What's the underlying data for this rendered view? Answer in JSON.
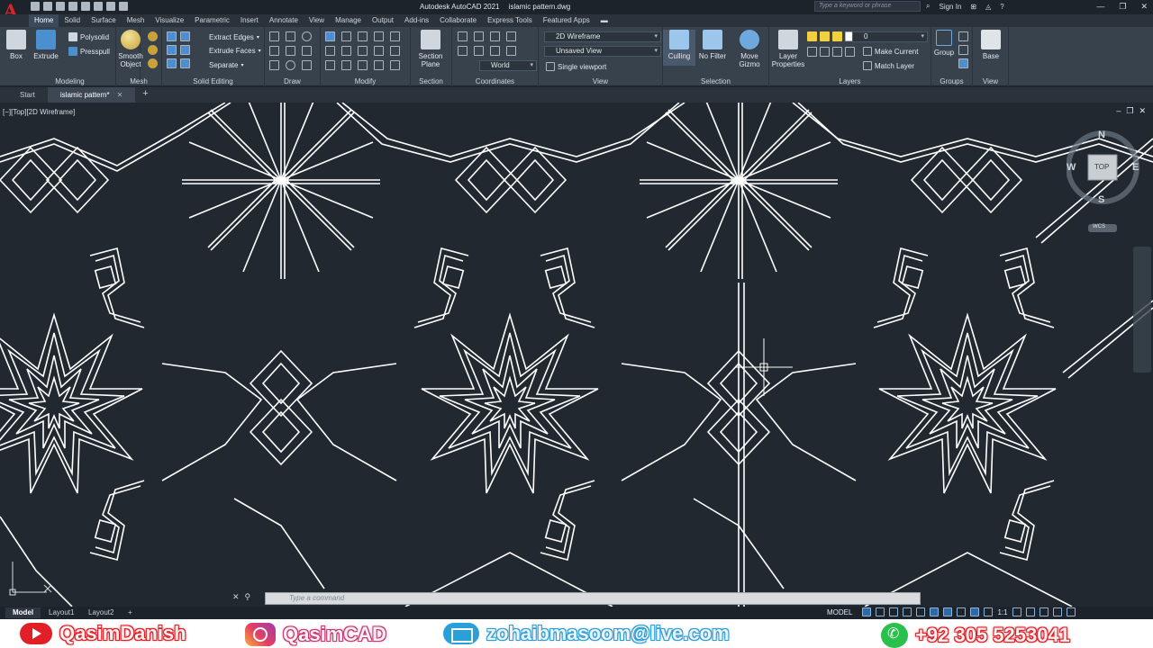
{
  "app": {
    "title": "Autodesk AutoCAD 2021",
    "filename": "islamic pattern.dwg",
    "search_placeholder": "Type a keyword or phrase",
    "sign_in": "Sign In"
  },
  "ribbon_tabs": [
    "Home",
    "Solid",
    "Surface",
    "Mesh",
    "Visualize",
    "Parametric",
    "Insert",
    "Annotate",
    "View",
    "Manage",
    "Output",
    "Add-ins",
    "Collaborate",
    "Express Tools",
    "Featured Apps"
  ],
  "ribbon": {
    "modeling": {
      "label": "Modeling",
      "box": "Box",
      "extrude": "Extrude",
      "polysolid": "Polysolid",
      "presspull": "Presspull"
    },
    "mesh": {
      "label": "Mesh",
      "smooth_object": "Smooth\nObject"
    },
    "solid_editing": {
      "label": "Solid Editing",
      "extract_edges": "Extract Edges",
      "extrude_faces": "Extrude Faces",
      "separate": "Separate"
    },
    "draw": {
      "label": "Draw"
    },
    "modify": {
      "label": "Modify"
    },
    "section": {
      "label": "Section",
      "section_plane": "Section\nPlane"
    },
    "coordinates": {
      "label": "Coordinates",
      "world": "World"
    },
    "view": {
      "label": "View",
      "visual_style": "2D Wireframe",
      "named_view": "Unsaved View",
      "viewport": "Single viewport"
    },
    "selection": {
      "label": "Selection",
      "culling": "Culling",
      "no_filter": "No Filter",
      "move_gizmo": "Move\nGizmo"
    },
    "layers": {
      "label": "Layers",
      "layer_properties": "Layer\nProperties",
      "current_layer": "0",
      "make_current": "Make Current",
      "match_layer": "Match Layer"
    },
    "groups": {
      "label": "Groups",
      "group": "Group"
    },
    "view2": {
      "label": "View",
      "base": "Base"
    }
  },
  "doc_tabs": [
    {
      "label": "Start"
    },
    {
      "label": "islamic pattern*"
    }
  ],
  "viewport": {
    "label": "[−][Top][2D Wireframe]",
    "viewcube_face": "TOP",
    "compass_n": "N",
    "compass_s": "S",
    "compass_e": "E",
    "compass_w": "W",
    "wcs": "WCS"
  },
  "command_line": {
    "placeholder": "Type a command"
  },
  "layout_tabs": [
    "Model",
    "Layout1",
    "Layout2"
  ],
  "status": {
    "space": "MODEL",
    "scale": "1:1"
  },
  "banner": {
    "youtube": "QasimDanish",
    "instagram": "QasimCAD",
    "email": "zohaibmasoom@live.com",
    "whatsapp": "+92 305 5253041"
  },
  "colors": {
    "canvas": "#212830",
    "ribbon": "#38424d",
    "line": "#ffffff",
    "accent": "#2e6aa8"
  }
}
